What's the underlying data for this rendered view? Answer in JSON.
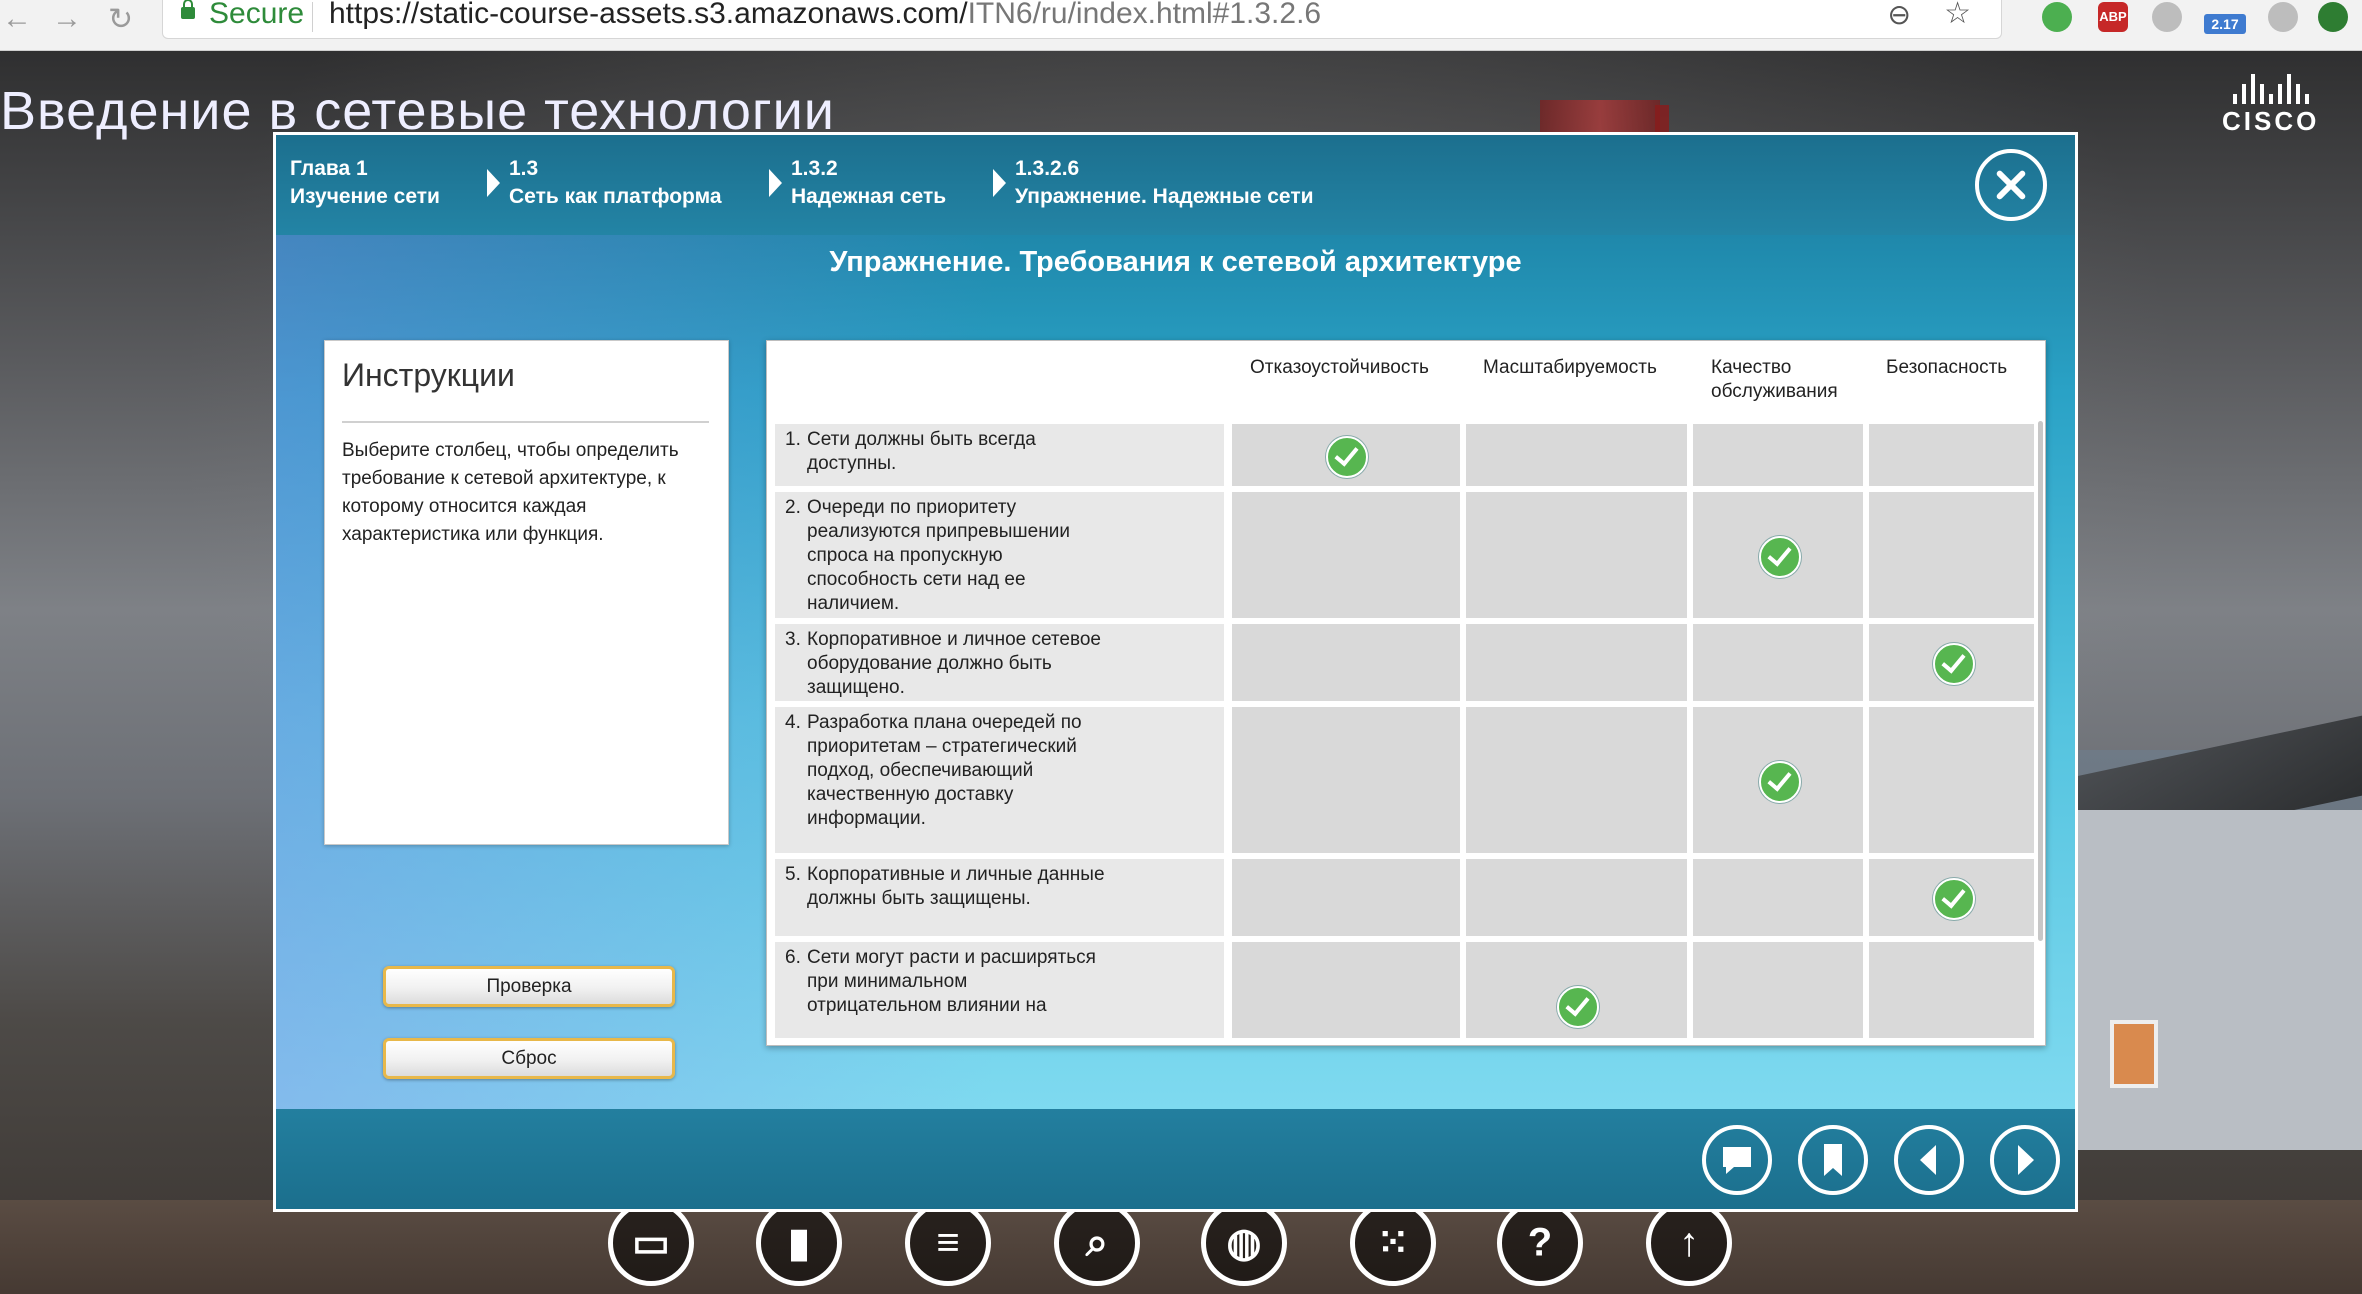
{
  "browser": {
    "secure_label": "Secure",
    "url_main": "https://static-course-assets.s3.amazonaws.com/",
    "url_tail": "ITN6/ru/index.html#1.3.2.6",
    "ext_abp": "ABP",
    "ext_badge": "2.17"
  },
  "page": {
    "course_title": "Введение в сетевые технологии",
    "logo_text": "CISCO"
  },
  "breadcrumb": [
    {
      "num": "Глава 1",
      "label": "Изучение сети"
    },
    {
      "num": "1.3",
      "label": "Сеть как платформа"
    },
    {
      "num": "1.3.2",
      "label": "Надежная сеть"
    },
    {
      "num": "1.3.2.6",
      "label": "Упражнение. Надежные сети"
    }
  ],
  "activity": {
    "title": "Упражнение. Требования к сетевой архитектуре",
    "instructions_heading": "Инструкции",
    "instructions_text": "Выберите столбец, чтобы определить требование к сетевой архитектуре, к которому относится каждая характеристика или функция.",
    "check_button": "Проверка",
    "reset_button": "Сброс"
  },
  "matrix": {
    "columns": [
      "Отказоустойчивость",
      "Масштабируемость",
      "Качество обслуживания",
      "Безопасность"
    ],
    "rows": [
      {
        "num": "1.",
        "text": "Сети должны быть всегда доступны.",
        "selected_column": "Отказоустойчивость"
      },
      {
        "num": "2.",
        "text": "Очереди по приоритету реализуются припревышении спроса на пропускную способность сети над ее наличием.",
        "selected_column": "Качество обслуживания"
      },
      {
        "num": "3.",
        "text": "Корпоративное и личное сетевое оборудование должно быть защищено.",
        "selected_column": "Безопасность"
      },
      {
        "num": "4.",
        "text": "Разработка плана очередей по приоритетам – стратегический подход, обеспечивающий качественную доставку информации.",
        "selected_column": "Качество обслуживания"
      },
      {
        "num": "5.",
        "text": "Корпоративные и личные данные должны быть защищены.",
        "selected_column": "Безопасность"
      },
      {
        "num": "6.",
        "text": "Сети могут расти и расширяться при минимальном отрицательном влиянии на",
        "selected_column": "Масштабируемость"
      }
    ]
  },
  "footer_icons": [
    "comment-icon",
    "bookmark-icon",
    "previous-icon",
    "next-icon"
  ],
  "toolbar_icons": [
    "document-icon",
    "bookmark-icon",
    "menu-icon",
    "search-icon",
    "globe-icon",
    "apps-icon",
    "help-icon",
    "up-arrow-icon"
  ]
}
